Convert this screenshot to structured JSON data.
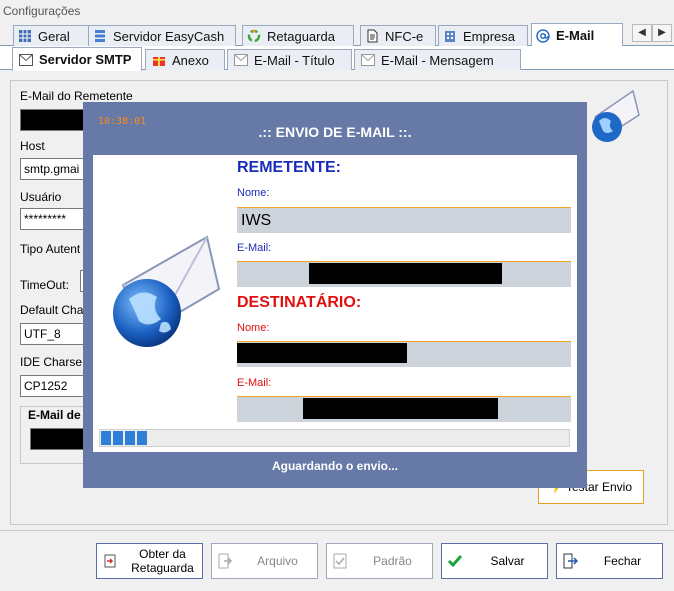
{
  "window": {
    "title": "Configurações"
  },
  "main_tabs": [
    {
      "label": "Geral",
      "icon": "grid-icon"
    },
    {
      "label": "Servidor EasyCash",
      "icon": "server-icon"
    },
    {
      "label": "Retaguarda",
      "icon": "recycle-icon"
    },
    {
      "label": "NFC-e",
      "icon": "document-icon"
    },
    {
      "label": "Empresa",
      "icon": "building-icon"
    },
    {
      "label": "E-Mail",
      "icon": "at-icon",
      "active": true
    }
  ],
  "sub_tabs": [
    {
      "label": "Servidor SMTP",
      "icon": "envelope-icon",
      "active": true
    },
    {
      "label": "Anexo",
      "icon": "gift-icon"
    },
    {
      "label": "E-Mail - Título",
      "icon": "envelope-icon"
    },
    {
      "label": "E-Mail - Mensagem",
      "icon": "envelope-icon"
    }
  ],
  "form": {
    "remetente_label": "E-Mail do Remetente",
    "host_label": "Host",
    "host_value": "smtp.gmai",
    "usuario_label": "Usuário",
    "usuario_value": "*********",
    "tipo_autent_label": "Tipo Autent",
    "timeout_label": "TimeOut:",
    "default_charset_label": "Default Cha",
    "default_charset_value": "UTF_8",
    "ide_charset_label": "IDE Charse",
    "ide_charset_value": "CP1252",
    "group_title": "E-Mail de",
    "testar_button": "Testar Envio"
  },
  "overlay": {
    "clock": "10:38:01",
    "title": ".:: ENVIO DE E-MAIL ::.",
    "remetente_heading": "REMETENTE:",
    "remetente_nome_label": "Nome:",
    "remetente_nome_value": "IWS",
    "remetente_email_label": "E-Mail:",
    "destinatario_heading": "DESTINATÁRIO:",
    "destinatario_nome_label": "Nome:",
    "destinatario_email_label": "E-Mail:",
    "progress_blocks": 4,
    "status": "Aguardando o envio..."
  },
  "buttons": {
    "obter_line1": "Obter da",
    "obter_line2": "Retaguarda",
    "arquivo": "Arquivo",
    "padrao": "Padrão",
    "salvar": "Salvar",
    "fechar": "Fechar"
  },
  "colors": {
    "overlay_bg": "#6779a6",
    "heading_blue": "#1a2db8",
    "heading_red": "#e01010",
    "clock_orange": "#ff8c1a",
    "progress_blue": "#2f7fd8"
  }
}
